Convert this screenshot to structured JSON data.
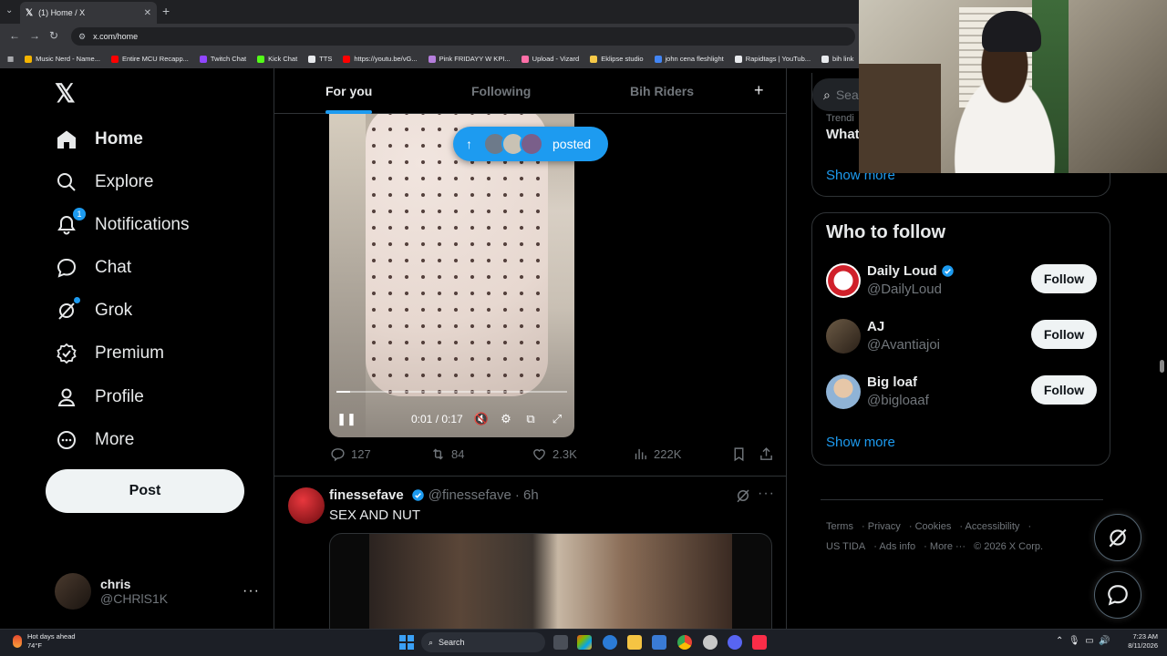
{
  "browser": {
    "tab_title": "(1) Home / X",
    "url": "x.com/home",
    "bookmarks": [
      {
        "label": "Music Nerd - Name...",
        "color": "#f4b400"
      },
      {
        "label": "Entire MCU Recapp...",
        "color": "#ff0000"
      },
      {
        "label": "Twitch Chat",
        "color": "#9146ff"
      },
      {
        "label": "Kick Chat",
        "color": "#53fc18"
      },
      {
        "label": "TTS",
        "color": "#e8eaed"
      },
      {
        "label": "https://youtu.be/vG...",
        "color": "#ff0000"
      },
      {
        "label": "Pink FRIDAYY W KPI...",
        "color": "#b57edc"
      },
      {
        "label": "Upload - Vizard",
        "color": "#ff6fa8"
      },
      {
        "label": "Eklipse studio",
        "color": "#f7c948"
      },
      {
        "label": "john cena fleshlight",
        "color": "#4285f4"
      },
      {
        "label": "Rapidtags | YouTub...",
        "color": "#e8eaed"
      },
      {
        "label": "bih link",
        "color": "#e8eaed"
      }
    ]
  },
  "sidebar": {
    "items": [
      {
        "label": "Home",
        "icon": "home-icon"
      },
      {
        "label": "Explore",
        "icon": "search-icon"
      },
      {
        "label": "Notifications",
        "icon": "bell-icon",
        "badge": "1"
      },
      {
        "label": "Chat",
        "icon": "chat-icon"
      },
      {
        "label": "Grok",
        "icon": "grok-icon"
      },
      {
        "label": "Premium",
        "icon": "premium-icon"
      },
      {
        "label": "Profile",
        "icon": "profile-icon"
      },
      {
        "label": "More",
        "icon": "more-icon"
      }
    ],
    "post_label": "Post",
    "account": {
      "name": "chris",
      "handle": "@CHRlS1K"
    }
  },
  "feed": {
    "tabs": [
      "For you",
      "Following",
      "Bih Riders"
    ],
    "posted_pill": "posted",
    "video": {
      "time": "0:01 / 0:17",
      "progress": 0.06
    },
    "post1_stats": {
      "replies": "127",
      "reposts": "84",
      "likes": "2.3K",
      "views": "222K"
    },
    "post2": {
      "name": "finessefave",
      "handle": "@finessefave",
      "time": "· 6h",
      "text": "SEX AND NUT"
    }
  },
  "right": {
    "search_placeholder": "Sea",
    "trend_small": "Trendi",
    "trend_title": "What",
    "show_more": "Show more",
    "who_to_follow_title": "Who to follow",
    "suggestions": [
      {
        "name": "Daily Loud",
        "handle": "@DailyLoud",
        "verified": true,
        "button": "Follow"
      },
      {
        "name": "AJ",
        "handle": "@Avantiajoi",
        "verified": false,
        "button": "Follow"
      },
      {
        "name": "Big loaf",
        "handle": "@bigloaaf",
        "verified": false,
        "button": "Follow"
      }
    ],
    "footer": {
      "terms": "Terms",
      "privacy": "Privacy",
      "cookies": "Cookies",
      "accessibility": "Accessibility",
      "ads_info_prefix": "US TIDA",
      "ads_info": "Ads info",
      "more": "More ···",
      "copyright": "© 2026 X Corp."
    }
  },
  "taskbar": {
    "weather_title": "Hot days ahead",
    "weather_temp": "74°F",
    "search": "Search",
    "time": "7:23 AM",
    "date": "8/11/2026"
  },
  "colors": {
    "accent": "#1d9bf0",
    "background": "#000000",
    "border": "#2f3336"
  }
}
